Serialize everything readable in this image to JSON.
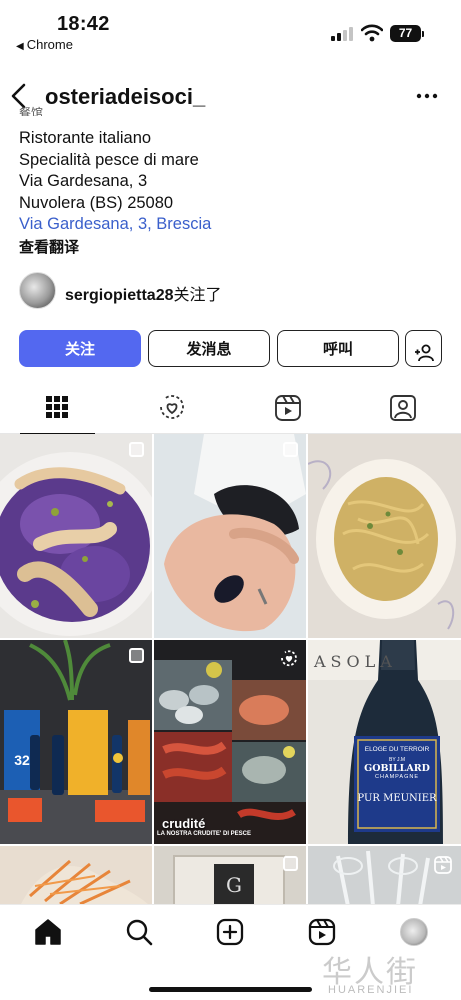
{
  "status_bar": {
    "time": "18:42",
    "back_app": "Chrome",
    "battery": "77"
  },
  "header": {
    "username": "osteriadeisoci_"
  },
  "bio": {
    "clipped_line": "餐馆",
    "lines": [
      "Ristorante italiano",
      "Specialità pesce di mare",
      "Via Gardesana, 3",
      "Nuvolera (BS) 25080"
    ],
    "location_link": "Via Gardesana, 3, Brescia",
    "translate": "查看翻译"
  },
  "followed_by": {
    "username": "sergiopietta28",
    "suffix": "关注了"
  },
  "actions": {
    "follow": "关注",
    "message": "发消息",
    "call": "呼叫"
  },
  "tabs": [
    {
      "icon": "grid-icon",
      "active": true
    },
    {
      "icon": "reels-heart-icon",
      "active": false
    },
    {
      "icon": "reels-icon",
      "active": false
    },
    {
      "icon": "tagged-icon",
      "active": false
    }
  ],
  "posts": [
    {
      "subject": "octopus on purple cabbage",
      "badge": "multi"
    },
    {
      "subject": "mussel in hand",
      "badge": "multi"
    },
    {
      "subject": "spaghetti with clams",
      "badge": "none"
    },
    {
      "subject": "32 Via dei Birrai beers",
      "badge": "multi"
    },
    {
      "subject": "raw seafood collage",
      "badge": "reel",
      "caption_title": "crudité",
      "caption_sub": "LA NOSTRA CRUDITE' DI PESCE"
    },
    {
      "subject": "champagne bottle",
      "badge": "none",
      "label_lines": [
        "ELOGE DU TERROIR",
        "BY J.M",
        "GOBILLARD",
        "CHAMPAGNE",
        "PUR MEUNIER"
      ],
      "top_text": "ASOLA"
    },
    {
      "subject": "carrot dish",
      "badge": "none"
    },
    {
      "subject": "framed picture",
      "badge": "multi"
    },
    {
      "subject": "glasses",
      "badge": "reel"
    }
  ],
  "bottom_nav": [
    "home-icon",
    "search-icon",
    "create-icon",
    "reels-icon",
    "profile-avatar"
  ],
  "watermark": {
    "text": "华人街",
    "sub": "HUARENJIEI"
  },
  "colors": {
    "follow_blue": "#5368f0",
    "link_blue": "#3a5fcb",
    "text": "#111111"
  }
}
